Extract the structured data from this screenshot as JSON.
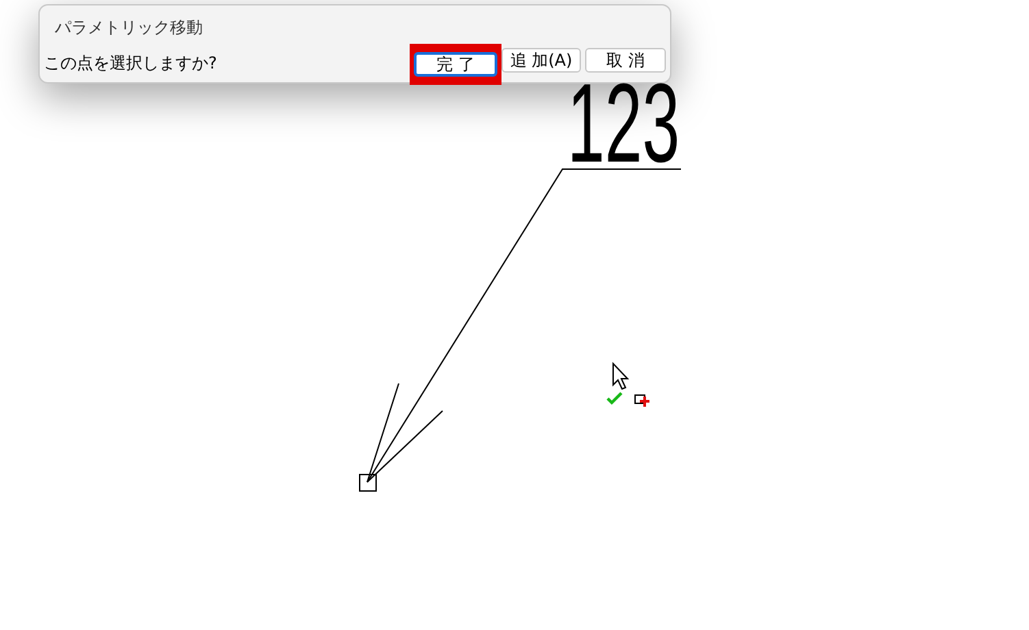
{
  "dialog": {
    "title": "パラメトリック移動",
    "prompt": "この点を選択しますか?",
    "buttons": [
      {
        "label": "完 了",
        "focused": true,
        "emphasized": true
      },
      {
        "label": "追 加(A)",
        "focused": false,
        "emphasized": false
      },
      {
        "label": "取 消",
        "focused": false,
        "emphasized": false
      }
    ]
  },
  "canvas": {
    "annotation_text": "123"
  }
}
